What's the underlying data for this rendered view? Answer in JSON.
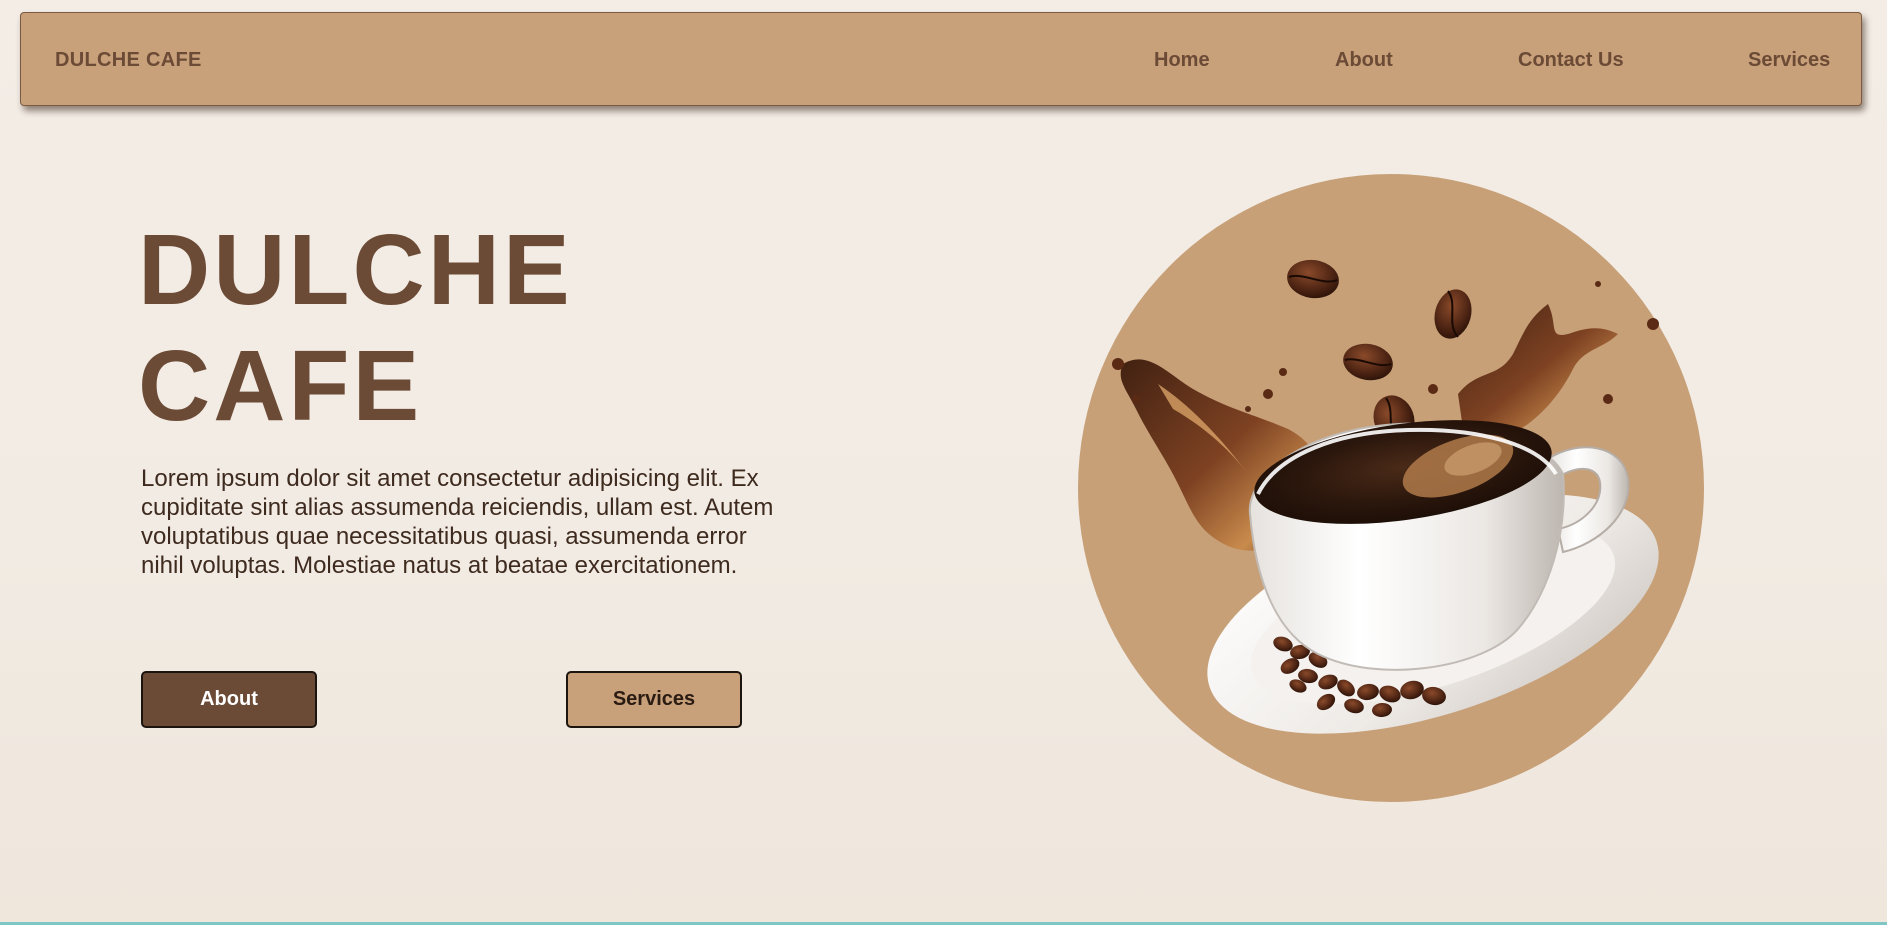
{
  "navbar": {
    "brand": "DULCHE CAFE",
    "links": [
      {
        "label": "Home"
      },
      {
        "label": "About"
      },
      {
        "label": "Contact Us"
      },
      {
        "label": "Services"
      }
    ]
  },
  "hero": {
    "title_line1": "DULCHE",
    "title_line2": "CAFE",
    "description": "Lorem ipsum dolor sit amet consectetur adipisicing elit. Ex cupiditate sint alias assumenda reiciendis, ullam est. Autem voluptatibus quae necessitatibus quasi, assumenda error nihil voluptas. Molestiae natus at beatae exercitationem.",
    "buttons": {
      "about": "About",
      "services": "Services"
    }
  },
  "colors": {
    "accent": "#c8a07a",
    "dark_brown": "#6c4b36",
    "background": "#f3ede6"
  },
  "image": {
    "subject": "coffee-cup-splash-illustration"
  }
}
